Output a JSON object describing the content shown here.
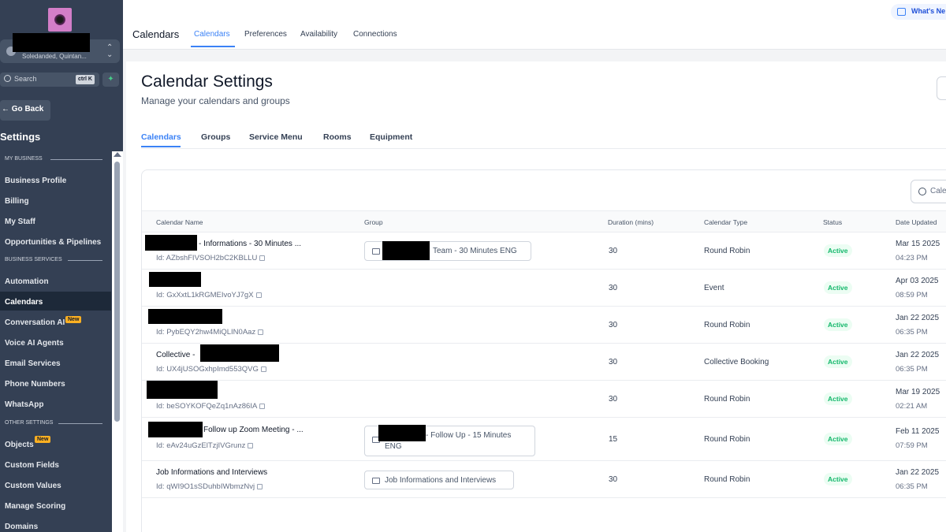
{
  "sidebar": {
    "account_sub": "Soledanded, Quintan...",
    "search_placeholder": "Search",
    "search_shortcut": "ctrl K",
    "go_back": "Go Back",
    "title": "Settings",
    "sections": {
      "my_business": "MY BUSINESS",
      "business_services": "BUSINESS SERVICES",
      "other_settings": "OTHER SETTINGS"
    },
    "items": [
      {
        "label": "Business Profile"
      },
      {
        "label": "Billing"
      },
      {
        "label": "My Staff"
      },
      {
        "label": "Opportunities & Pipelines"
      },
      {
        "label": "Automation"
      },
      {
        "label": "Calendars"
      },
      {
        "label": "Conversation AI",
        "badge": "New"
      },
      {
        "label": "Voice AI Agents"
      },
      {
        "label": "Email Services"
      },
      {
        "label": "Phone Numbers"
      },
      {
        "label": "WhatsApp"
      },
      {
        "label": "Objects",
        "badge": "New"
      },
      {
        "label": "Custom Fields"
      },
      {
        "label": "Custom Values"
      },
      {
        "label": "Manage Scoring"
      },
      {
        "label": "Domains"
      }
    ]
  },
  "topbar": {
    "title": "Calendars",
    "tabs": [
      "Calendars",
      "Preferences",
      "Availability",
      "Connections"
    ],
    "whats_new": "What's Ne"
  },
  "page": {
    "title": "Calendar Settings",
    "subtitle": "Manage your calendars and groups",
    "tabs": [
      "Calendars",
      "Groups",
      "Service Menu",
      "Rooms",
      "Equipment"
    ],
    "search_placeholder": "Cale"
  },
  "table": {
    "columns": [
      "Calendar Name",
      "Group",
      "Duration (mins)",
      "Calendar Type",
      "Status",
      "Date Updated"
    ],
    "rows": [
      {
        "name": "- Informations - 30 Minutes ...",
        "id": "Id: AZbshFIVSOH2bC2KBLLU",
        "group": "Team - 30 Minutes ENG",
        "group2": "",
        "duration": "30",
        "type": "Round Robin",
        "status": "Active",
        "date": "Mar 15 2025",
        "time": "04:23 PM"
      },
      {
        "name": "",
        "id": "Id: GxXxtL1kRGMEIvoYJ7gX",
        "group": "",
        "group2": "",
        "duration": "30",
        "type": "Event",
        "status": "Active",
        "date": "Apr 03 2025",
        "time": "08:59 PM"
      },
      {
        "name": "",
        "id": "Id: PybEQY2hw4MiQLIN0Aaz",
        "group": "",
        "group2": "",
        "duration": "30",
        "type": "Round Robin",
        "status": "Active",
        "date": "Jan 22 2025",
        "time": "06:35 PM"
      },
      {
        "name": "Collective -",
        "id": "Id: UX4jUSOGxhpImd553QVG",
        "group": "",
        "group2": "",
        "duration": "30",
        "type": "Collective Booking",
        "status": "Active",
        "date": "Jan 22 2025",
        "time": "06:35 PM"
      },
      {
        "name": "",
        "id": "Id: beSOYKOFQeZq1nAz86IA",
        "group": "",
        "group2": "",
        "duration": "30",
        "type": "Round Robin",
        "status": "Active",
        "date": "Mar 19 2025",
        "time": "02:21 AM"
      },
      {
        "name": "Follow up Zoom Meeting - ...",
        "id": "Id: eAv24uGzElTzjIVGrunz",
        "group": "- Follow Up - 15 Minutes",
        "group2": "ENG",
        "duration": "15",
        "type": "Round Robin",
        "status": "Active",
        "date": "Feb 11 2025",
        "time": "07:59 PM"
      },
      {
        "name": "Job Informations and Interviews",
        "id": "Id: qWI9O1sSDuhbIWbmzNvj",
        "group": "Job Informations and Interviews",
        "group2": "",
        "duration": "30",
        "type": "Round Robin",
        "status": "Active",
        "date": "Jan 22 2025",
        "time": "06:35 PM"
      }
    ]
  }
}
